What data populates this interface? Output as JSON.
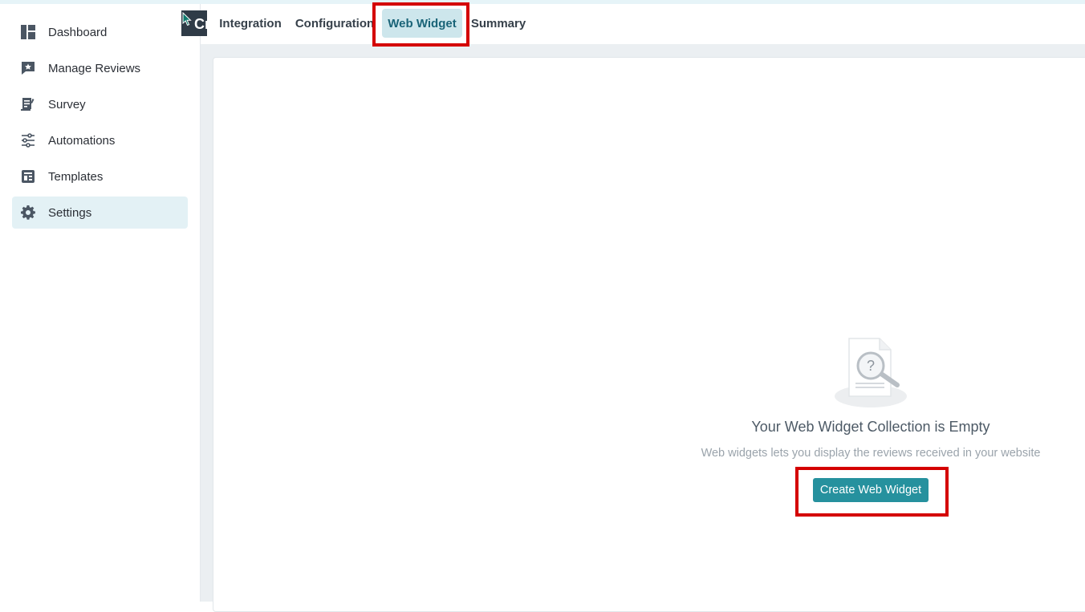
{
  "sidebar": {
    "items": [
      {
        "label": "Dashboard",
        "icon": "dashboard-icon"
      },
      {
        "label": "Manage Reviews",
        "icon": "review-chat-icon"
      },
      {
        "label": "Survey",
        "icon": "survey-icon"
      },
      {
        "label": "Automations",
        "icon": "sliders-icon"
      },
      {
        "label": "Templates",
        "icon": "template-icon"
      },
      {
        "label": "Settings",
        "icon": "gear-icon",
        "active": true
      }
    ]
  },
  "overlay_tab": {
    "label": "Cr"
  },
  "tabs": [
    {
      "label": "Integration"
    },
    {
      "label": "Configuration"
    },
    {
      "label": "Web Widget",
      "active": true
    },
    {
      "label": "Summary"
    }
  ],
  "empty_state": {
    "title": "Your Web Widget Collection is Empty",
    "description": "Web widgets lets you display the reviews received in your website",
    "button_label": "Create Web Widget",
    "icon": "document-search-icon"
  },
  "colors": {
    "accent": "#26919e",
    "active_tab_bg": "#cde6ec",
    "highlight": "#d40000",
    "sidebar_active_bg": "#e3f1f5"
  }
}
